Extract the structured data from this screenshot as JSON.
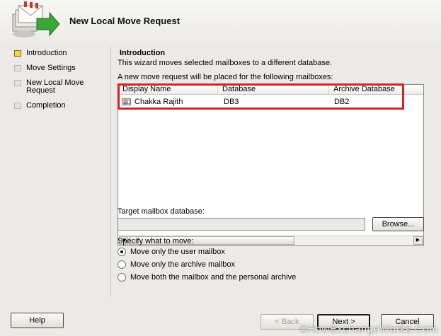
{
  "window": {
    "title": "New Local Move Request"
  },
  "nav": {
    "items": [
      {
        "label": "Introduction",
        "active": true
      },
      {
        "label": "Move Settings",
        "active": false
      },
      {
        "label": "New Local Move Request",
        "active": false
      },
      {
        "label": "Completion",
        "active": false
      }
    ]
  },
  "intro": {
    "heading": "Introduction",
    "description": "This wizard moves selected mailboxes to a different database.",
    "list_label": "A new move request will be placed for the following mailboxes:"
  },
  "mailbox_table": {
    "columns": [
      "Display Name",
      "Database",
      "Archive Database"
    ],
    "rows": [
      {
        "display_name": "Chakka Rajith",
        "database": "DB3",
        "archive_database": "DB2",
        "icon": "mailbox-user-icon"
      }
    ]
  },
  "target": {
    "label": "Target mailbox database:",
    "value": "",
    "browse_label": "Browse..."
  },
  "move_options": {
    "label": "Specify what to move:",
    "options": [
      {
        "label": "Move only the user mailbox",
        "checked": true
      },
      {
        "label": "Move only the archive mailbox",
        "checked": false
      },
      {
        "label": "Move both the mailbox and the personal archive",
        "checked": false
      }
    ]
  },
  "footer": {
    "help_label": "Help",
    "back_label": "< Back",
    "next_label": "Next >",
    "cancel_label": "Cancel",
    "watermark": "©HowExchangeWorks.Com"
  },
  "colors": {
    "highlight": "#d6202a",
    "active_nav": "#f3d24c"
  }
}
